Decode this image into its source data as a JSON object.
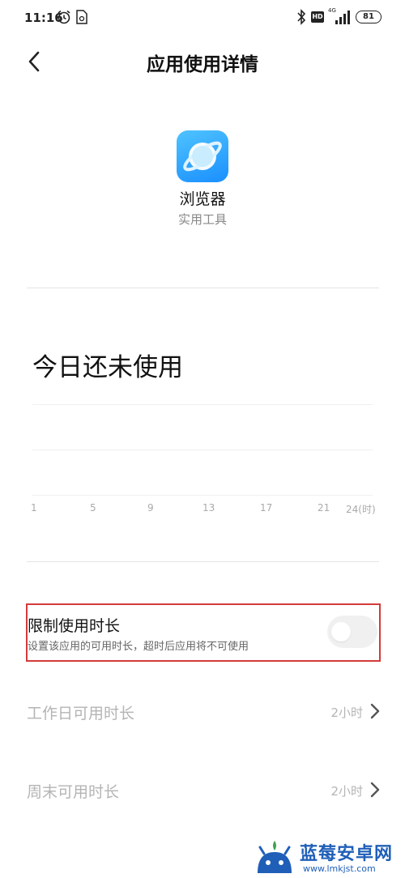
{
  "status_bar": {
    "time": "11:16",
    "network": "4G",
    "hd_label": "HD",
    "battery": "81"
  },
  "header": {
    "title": "应用使用详情"
  },
  "app": {
    "name": "浏览器",
    "category": "实用工具",
    "icon": "browser-planet-icon",
    "icon_color": "#1a8fff"
  },
  "usage": {
    "status": "今日还未使用",
    "x_ticks": [
      "1",
      "5",
      "9",
      "13",
      "17",
      "21",
      "24(时)"
    ]
  },
  "limit": {
    "title": "限制使用时长",
    "description": "设置该应用的可用时长，超时后应用将不可使用",
    "enabled": false
  },
  "settings": [
    {
      "label": "工作日可用时长",
      "value": "2小时"
    },
    {
      "label": "周末可用时长",
      "value": "2小时"
    }
  ],
  "watermark": {
    "title": "蓝莓安卓网",
    "url": "www.lmkjst.com"
  },
  "colors": {
    "highlight_border": "#d23b3b",
    "disabled_text": "#b4b4b4",
    "watermark": "#1f5fb8"
  }
}
